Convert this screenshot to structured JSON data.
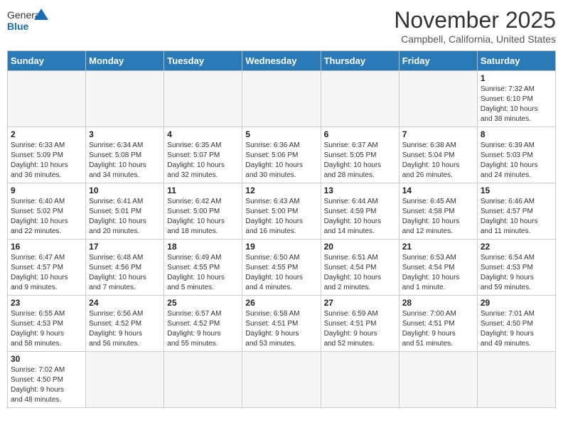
{
  "header": {
    "logo_general": "General",
    "logo_blue": "Blue",
    "month_year": "November 2025",
    "location": "Campbell, California, United States"
  },
  "days_of_week": [
    "Sunday",
    "Monday",
    "Tuesday",
    "Wednesday",
    "Thursday",
    "Friday",
    "Saturday"
  ],
  "weeks": [
    [
      {
        "day": "",
        "info": ""
      },
      {
        "day": "",
        "info": ""
      },
      {
        "day": "",
        "info": ""
      },
      {
        "day": "",
        "info": ""
      },
      {
        "day": "",
        "info": ""
      },
      {
        "day": "",
        "info": ""
      },
      {
        "day": "1",
        "info": "Sunrise: 7:32 AM\nSunset: 6:10 PM\nDaylight: 10 hours\nand 38 minutes."
      }
    ],
    [
      {
        "day": "2",
        "info": "Sunrise: 6:33 AM\nSunset: 5:09 PM\nDaylight: 10 hours\nand 36 minutes."
      },
      {
        "day": "3",
        "info": "Sunrise: 6:34 AM\nSunset: 5:08 PM\nDaylight: 10 hours\nand 34 minutes."
      },
      {
        "day": "4",
        "info": "Sunrise: 6:35 AM\nSunset: 5:07 PM\nDaylight: 10 hours\nand 32 minutes."
      },
      {
        "day": "5",
        "info": "Sunrise: 6:36 AM\nSunset: 5:06 PM\nDaylight: 10 hours\nand 30 minutes."
      },
      {
        "day": "6",
        "info": "Sunrise: 6:37 AM\nSunset: 5:05 PM\nDaylight: 10 hours\nand 28 minutes."
      },
      {
        "day": "7",
        "info": "Sunrise: 6:38 AM\nSunset: 5:04 PM\nDaylight: 10 hours\nand 26 minutes."
      },
      {
        "day": "8",
        "info": "Sunrise: 6:39 AM\nSunset: 5:03 PM\nDaylight: 10 hours\nand 24 minutes."
      }
    ],
    [
      {
        "day": "9",
        "info": "Sunrise: 6:40 AM\nSunset: 5:02 PM\nDaylight: 10 hours\nand 22 minutes."
      },
      {
        "day": "10",
        "info": "Sunrise: 6:41 AM\nSunset: 5:01 PM\nDaylight: 10 hours\nand 20 minutes."
      },
      {
        "day": "11",
        "info": "Sunrise: 6:42 AM\nSunset: 5:00 PM\nDaylight: 10 hours\nand 18 minutes."
      },
      {
        "day": "12",
        "info": "Sunrise: 6:43 AM\nSunset: 5:00 PM\nDaylight: 10 hours\nand 16 minutes."
      },
      {
        "day": "13",
        "info": "Sunrise: 6:44 AM\nSunset: 4:59 PM\nDaylight: 10 hours\nand 14 minutes."
      },
      {
        "day": "14",
        "info": "Sunrise: 6:45 AM\nSunset: 4:58 PM\nDaylight: 10 hours\nand 12 minutes."
      },
      {
        "day": "15",
        "info": "Sunrise: 6:46 AM\nSunset: 4:57 PM\nDaylight: 10 hours\nand 11 minutes."
      }
    ],
    [
      {
        "day": "16",
        "info": "Sunrise: 6:47 AM\nSunset: 4:57 PM\nDaylight: 10 hours\nand 9 minutes."
      },
      {
        "day": "17",
        "info": "Sunrise: 6:48 AM\nSunset: 4:56 PM\nDaylight: 10 hours\nand 7 minutes."
      },
      {
        "day": "18",
        "info": "Sunrise: 6:49 AM\nSunset: 4:55 PM\nDaylight: 10 hours\nand 5 minutes."
      },
      {
        "day": "19",
        "info": "Sunrise: 6:50 AM\nSunset: 4:55 PM\nDaylight: 10 hours\nand 4 minutes."
      },
      {
        "day": "20",
        "info": "Sunrise: 6:51 AM\nSunset: 4:54 PM\nDaylight: 10 hours\nand 2 minutes."
      },
      {
        "day": "21",
        "info": "Sunrise: 6:53 AM\nSunset: 4:54 PM\nDaylight: 10 hours\nand 1 minute."
      },
      {
        "day": "22",
        "info": "Sunrise: 6:54 AM\nSunset: 4:53 PM\nDaylight: 9 hours\nand 59 minutes."
      }
    ],
    [
      {
        "day": "23",
        "info": "Sunrise: 6:55 AM\nSunset: 4:53 PM\nDaylight: 9 hours\nand 58 minutes."
      },
      {
        "day": "24",
        "info": "Sunrise: 6:56 AM\nSunset: 4:52 PM\nDaylight: 9 hours\nand 56 minutes."
      },
      {
        "day": "25",
        "info": "Sunrise: 6:57 AM\nSunset: 4:52 PM\nDaylight: 9 hours\nand 55 minutes."
      },
      {
        "day": "26",
        "info": "Sunrise: 6:58 AM\nSunset: 4:51 PM\nDaylight: 9 hours\nand 53 minutes."
      },
      {
        "day": "27",
        "info": "Sunrise: 6:59 AM\nSunset: 4:51 PM\nDaylight: 9 hours\nand 52 minutes."
      },
      {
        "day": "28",
        "info": "Sunrise: 7:00 AM\nSunset: 4:51 PM\nDaylight: 9 hours\nand 51 minutes."
      },
      {
        "day": "29",
        "info": "Sunrise: 7:01 AM\nSunset: 4:50 PM\nDaylight: 9 hours\nand 49 minutes."
      }
    ],
    [
      {
        "day": "30",
        "info": "Sunrise: 7:02 AM\nSunset: 4:50 PM\nDaylight: 9 hours\nand 48 minutes."
      },
      {
        "day": "",
        "info": ""
      },
      {
        "day": "",
        "info": ""
      },
      {
        "day": "",
        "info": ""
      },
      {
        "day": "",
        "info": ""
      },
      {
        "day": "",
        "info": ""
      },
      {
        "day": "",
        "info": ""
      }
    ]
  ],
  "colors": {
    "header_bg": "#2a7ab8",
    "logo_blue": "#1a6db5"
  }
}
